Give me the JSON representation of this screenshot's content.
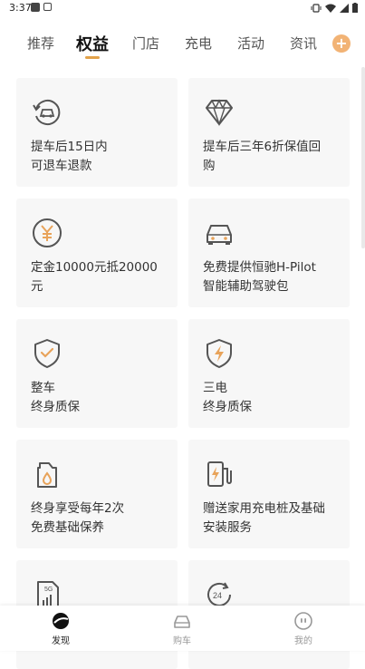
{
  "status_bar": {
    "time": "3:37"
  },
  "tabs": [
    {
      "label": "推荐"
    },
    {
      "label": "权益"
    },
    {
      "label": "门店"
    },
    {
      "label": "充电"
    },
    {
      "label": "活动"
    },
    {
      "label": "资讯"
    }
  ],
  "add_button": "+",
  "cards": [
    {
      "icon": "refund-car-icon",
      "line1": "提车后15日内",
      "line2": "可退车退款"
    },
    {
      "icon": "diamond-icon",
      "line1": "提车后三年6折保值回",
      "line2": "购"
    },
    {
      "icon": "yuan-coin-icon",
      "line1": "定金10000元抵20000",
      "line2": "元"
    },
    {
      "icon": "car-icon",
      "line1": "免费提供恒驰H-Pilot",
      "line2": "智能辅助驾驶包"
    },
    {
      "icon": "shield-check-icon",
      "line1": "整车",
      "line2": "终身质保"
    },
    {
      "icon": "shield-bolt-icon",
      "line1": "三电",
      "line2": "终身质保"
    },
    {
      "icon": "oil-can-icon",
      "line1": "终身享受每年2次",
      "line2": "免费基础保养"
    },
    {
      "icon": "charger-icon",
      "line1": "赠送家用充电桩及基础",
      "line2": "安装服务"
    },
    {
      "icon": "sim-5g-icon",
      "line1": "",
      "line2": ""
    },
    {
      "icon": "24h-service-icon",
      "line1": "",
      "line2": ""
    }
  ],
  "sim_label": "5G",
  "service_label": "24",
  "bottom_nav": [
    {
      "label": "发现"
    },
    {
      "label": "购车"
    },
    {
      "label": "我的"
    }
  ],
  "colors": {
    "accent": "#e2a24a",
    "icon_stroke": "#555555",
    "icon_accent": "#e8a35a"
  }
}
